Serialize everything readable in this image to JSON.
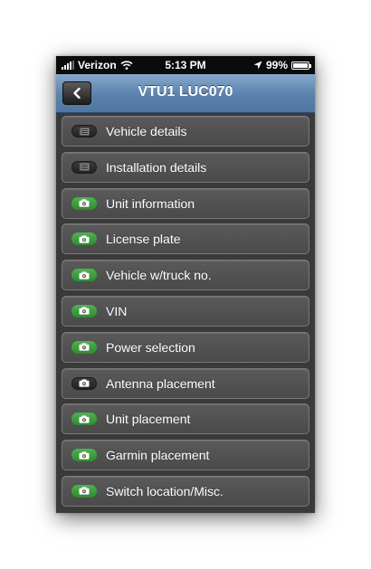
{
  "status_bar": {
    "carrier": "Verizon",
    "time": "5:13 PM",
    "battery": "99%",
    "battery_level": 0.99,
    "icons": [
      "signal-bars-icon",
      "wifi-icon",
      "location-arrow-icon",
      "battery-icon"
    ]
  },
  "nav": {
    "title": "VTU1 LUC070",
    "back_icon": "chevron-left-icon"
  },
  "items": [
    {
      "label": "Vehicle details",
      "icon": "document-icon",
      "status": "dark"
    },
    {
      "label": "Installation details",
      "icon": "document-icon",
      "status": "dark"
    },
    {
      "label": "Unit information",
      "icon": "camera-icon",
      "status": "green"
    },
    {
      "label": "License plate",
      "icon": "camera-icon",
      "status": "green"
    },
    {
      "label": "Vehicle w/truck no.",
      "icon": "camera-icon",
      "status": "green"
    },
    {
      "label": "VIN",
      "icon": "camera-icon",
      "status": "green"
    },
    {
      "label": "Power selection",
      "icon": "camera-icon",
      "status": "green"
    },
    {
      "label": "Antenna placement",
      "icon": "camera-icon",
      "status": "dark"
    },
    {
      "label": "Unit placement",
      "icon": "camera-icon",
      "status": "green"
    },
    {
      "label": "Garmin placement",
      "icon": "camera-icon",
      "status": "green"
    },
    {
      "label": "Switch location/Misc.",
      "icon": "camera-icon",
      "status": "green"
    }
  ],
  "colors": {
    "nav_blue": "#5b82ad",
    "status_green": "#3a9e3a",
    "background": "#3a3a3a"
  }
}
